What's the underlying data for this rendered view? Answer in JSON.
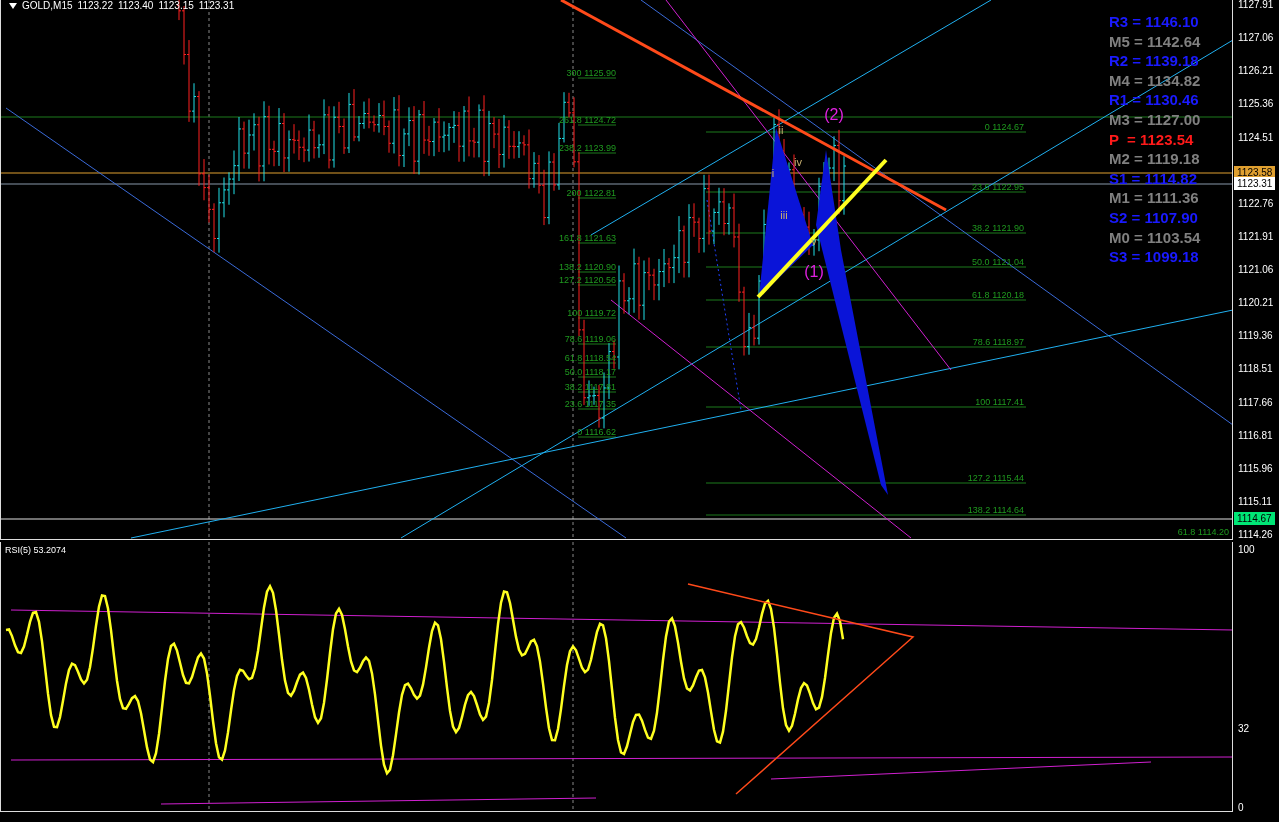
{
  "chart": {
    "symbol": "GOLD,M15",
    "quotes": [
      "1123.22",
      "1123.40",
      "1123.15",
      "1123.31"
    ],
    "price_axis": [
      "1127.91",
      "1127.06",
      "1126.21",
      "1125.36",
      "1124.51",
      "1122.76",
      "1121.91",
      "1121.06",
      "1120.21",
      "1119.36",
      "1118.51",
      "1117.66",
      "1116.81",
      "1115.96",
      "1115.11",
      "1114.26"
    ],
    "price_tags": [
      {
        "label": "1123.58",
        "color": "#e0a030"
      },
      {
        "label": "1123.31",
        "color": "#ffffff"
      },
      {
        "label": "1114.67",
        "color": "#00e676"
      }
    ],
    "pivots": [
      {
        "text": "R3 = 1146.10",
        "kind": "resistance"
      },
      {
        "text": "M5 = 1142.64",
        "kind": "mid"
      },
      {
        "text": "R2 = 1139.18",
        "kind": "resistance"
      },
      {
        "text": "M4 = 1134.82",
        "kind": "mid"
      },
      {
        "text": "R1 = 1130.46",
        "kind": "resistance"
      },
      {
        "text": "M3 = 1127.00",
        "kind": "mid"
      },
      {
        "text": "P  = 1123.54",
        "kind": "pivot"
      },
      {
        "text": "M2 = 1119.18",
        "kind": "mid"
      },
      {
        "text": "S1 = 1114.82",
        "kind": "support"
      },
      {
        "text": "M1 = 1111.36",
        "kind": "mid"
      },
      {
        "text": "S2 = 1107.90",
        "kind": "support"
      },
      {
        "text": "M0 = 1103.54",
        "kind": "mid"
      },
      {
        "text": "S3 = 1099.18",
        "kind": "support"
      }
    ],
    "fib_left": [
      "300 1125.90",
      "261.8 1124.72",
      "238.2 1123.99",
      "200 1122.81",
      "161.8 1121.63",
      "138.2 1120.90",
      "127.2 1120.56",
      "100 1119.72",
      "78.6 1119.06",
      "61.8 1118.54",
      "50.0 1118.17",
      "38.2 1117.81",
      "23.6 1117.35",
      "0 1116.62"
    ],
    "fib_right": [
      "0 1124.67",
      "23.6 1122.95",
      "38.2 1121.90",
      "50.0 1121.04",
      "61.8 1120.18",
      "78.6 1118.97",
      "100 1117.41",
      "127.2 1115.44",
      "138.2 1114.64"
    ],
    "fib_extra": "61.8 1114.20",
    "waves": [
      {
        "label": "(2)",
        "kind": "major"
      },
      {
        "label": "ii",
        "kind": "minor"
      },
      {
        "label": "iv",
        "kind": "minor"
      },
      {
        "label": "i",
        "kind": "minor"
      },
      {
        "label": "iii",
        "kind": "minor"
      },
      {
        "label": "v",
        "kind": "minor"
      },
      {
        "label": "(1)",
        "kind": "major"
      }
    ]
  },
  "rsi": {
    "title": "RSI(5) 53.2074",
    "axis": [
      "100",
      "32",
      "0"
    ]
  }
}
